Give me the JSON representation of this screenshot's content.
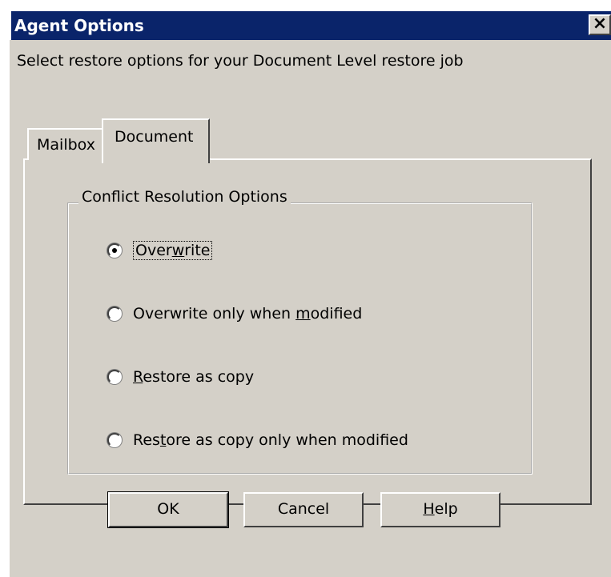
{
  "window": {
    "title": "Agent Options",
    "close_glyph": "×"
  },
  "instruction": "Select restore options for your Document Level restore job",
  "tabs": [
    {
      "label": "Mailbox",
      "selected": false
    },
    {
      "label": "Document",
      "selected": true
    }
  ],
  "group": {
    "label": "Conflict Resolution Options",
    "options": [
      {
        "pre": "",
        "accel": "",
        "post": "Over",
        "accel2": "w",
        "post2": "rite",
        "checked": true
      },
      {
        "pre": "Overwrite only when ",
        "accel": "m",
        "post": "odified",
        "checked": false
      },
      {
        "pre": "",
        "accel": "R",
        "post": "estore as copy",
        "checked": false
      },
      {
        "pre": "Res",
        "accel": "t",
        "post": "ore as copy only when modified",
        "checked": false
      }
    ]
  },
  "buttons": {
    "ok": "OK",
    "cancel": "Cancel",
    "help_accel": "H",
    "help_rest": "elp"
  }
}
